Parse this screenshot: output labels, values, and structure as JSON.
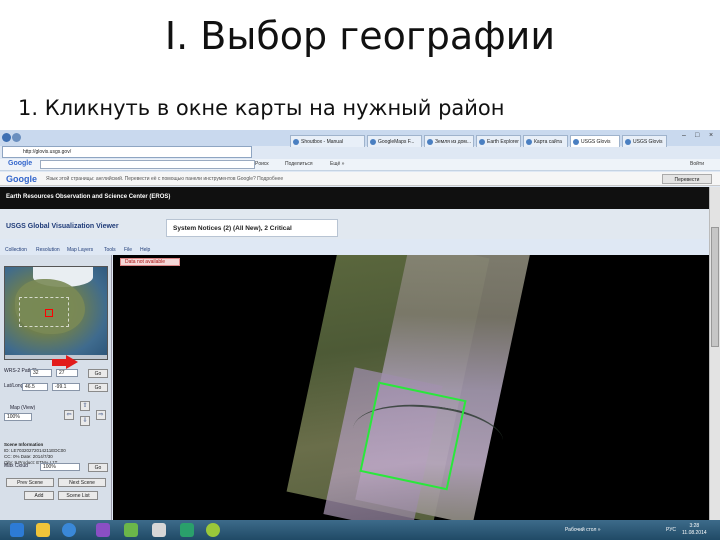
{
  "slide": {
    "title": "I. Выбор географии",
    "subtitle": "1. Кликнуть в окне карты на нужный район"
  },
  "browser": {
    "address": "http://glovis.usgs.gov/",
    "tabs": [
      "Shoutbox - Manual",
      "GoogleMaps F...",
      "Земля из дом...",
      "Earth Explorer",
      "Карта сайта",
      "USGS Glovis",
      "USGS Glovis"
    ],
    "window_controls": [
      "–",
      "□",
      "×"
    ]
  },
  "google_toolbar": {
    "logo": "Google",
    "menu": [
      "Poиск",
      "Поделиться",
      "Ещё »"
    ],
    "right": "Войти"
  },
  "translate_bar": {
    "logo": "Google",
    "message": "Язык этой страницы: английский. Перевести её с помощью панели инструментов Google? Подробнее",
    "button": "Перевести"
  },
  "eros": {
    "header": "Earth Resources Observation and Science Center (EROS)"
  },
  "glovis": {
    "title": "USGS Global Visualization Viewer",
    "notices": "System Notices (2) (All New), 2 Critical",
    "menu": [
      "Collection",
      "Resolution",
      "Map Layers",
      "Tools",
      "File",
      "Help"
    ],
    "not_available": "Data not available"
  },
  "panel": {
    "wrs_label": "WRS-2 Path/Row",
    "path": "32",
    "row": "27",
    "go": "Go",
    "latlong_label": "Lat/Long",
    "lat": "46.5",
    "long": "-99.1",
    "map_label": "Map (View)",
    "zoom": "100%",
    "scene_info_label": "Scene Information",
    "scene_info": [
      "ID: LE70320272014211EDC00",
      "CC: 0%  Date: 2014/7/30",
      "Qlty: 9  Product: ETM+ L1T"
    ],
    "max_cc": "Max Cloud",
    "cc_value": "100%",
    "prev_scene": "Prev Scene",
    "next_scene": "Next Scene",
    "add": "Add",
    "scene_list": "Scene List"
  },
  "taskbar": {
    "tray_text": "Рабочий стол »",
    "lang": "РУС",
    "time": "3:28",
    "date": "11.08.2014"
  }
}
